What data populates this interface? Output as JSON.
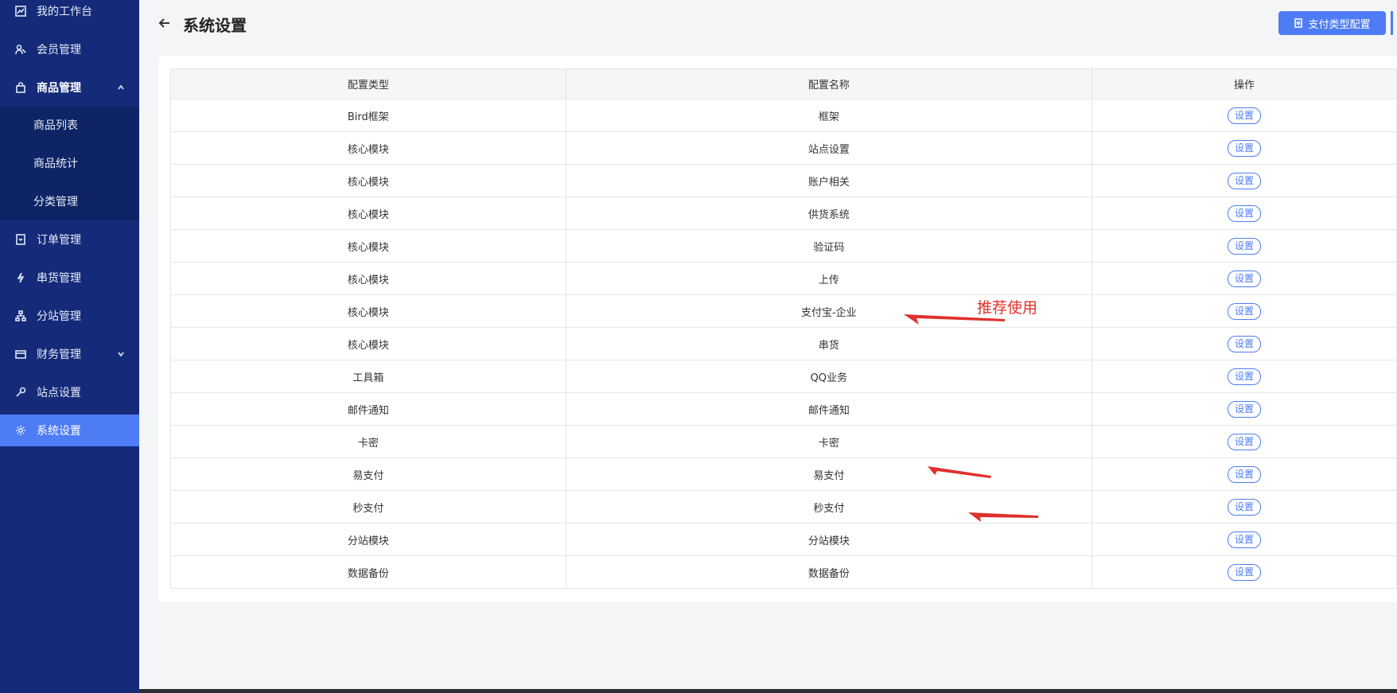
{
  "sidebar": {
    "items": [
      {
        "label": "我的工作台",
        "icon": "chart-icon"
      },
      {
        "label": "会员管理",
        "icon": "users-icon"
      },
      {
        "label": "商品管理",
        "icon": "bag-icon"
      },
      {
        "label": "订单管理",
        "icon": "order-icon"
      },
      {
        "label": "串货管理",
        "icon": "bolt-icon"
      },
      {
        "label": "分站管理",
        "icon": "sitemap-icon"
      },
      {
        "label": "财务管理",
        "icon": "wallet-icon"
      },
      {
        "label": "站点设置",
        "icon": "wrench-icon"
      },
      {
        "label": "系统设置",
        "icon": "gear-icon"
      }
    ],
    "submenu": [
      {
        "label": "商品列表"
      },
      {
        "label": "商品统计"
      },
      {
        "label": "分类管理"
      }
    ]
  },
  "header": {
    "title": "系统设置",
    "config_button": "支付类型配置"
  },
  "table": {
    "headers": [
      "配置类型",
      "配置名称",
      "操作"
    ],
    "rows": [
      {
        "type": "Bird框架",
        "name": "框架",
        "action": "设置"
      },
      {
        "type": "核心模块",
        "name": "站点设置",
        "action": "设置"
      },
      {
        "type": "核心模块",
        "name": "账户相关",
        "action": "设置"
      },
      {
        "type": "核心模块",
        "name": "供货系统",
        "action": "设置"
      },
      {
        "type": "核心模块",
        "name": "验证码",
        "action": "设置"
      },
      {
        "type": "核心模块",
        "name": "上传",
        "action": "设置"
      },
      {
        "type": "核心模块",
        "name": "支付宝-企业",
        "action": "设置"
      },
      {
        "type": "核心模块",
        "name": "串货",
        "action": "设置"
      },
      {
        "type": "工具箱",
        "name": "QQ业务",
        "action": "设置"
      },
      {
        "type": "邮件通知",
        "name": "邮件通知",
        "action": "设置"
      },
      {
        "type": "卡密",
        "name": "卡密",
        "action": "设置"
      },
      {
        "type": "易支付",
        "name": "易支付",
        "action": "设置"
      },
      {
        "type": "秒支付",
        "name": "秒支付",
        "action": "设置"
      },
      {
        "type": "分站模块",
        "name": "分站模块",
        "action": "设置"
      },
      {
        "type": "数据备份",
        "name": "数据备份",
        "action": "设置"
      }
    ]
  },
  "annotation": {
    "text": "推荐使用",
    "color": "#e0312c"
  },
  "colors": {
    "sidebar_bg": "#152b7a",
    "submenu_bg": "#0e2466",
    "accent": "#4e7cf4"
  }
}
